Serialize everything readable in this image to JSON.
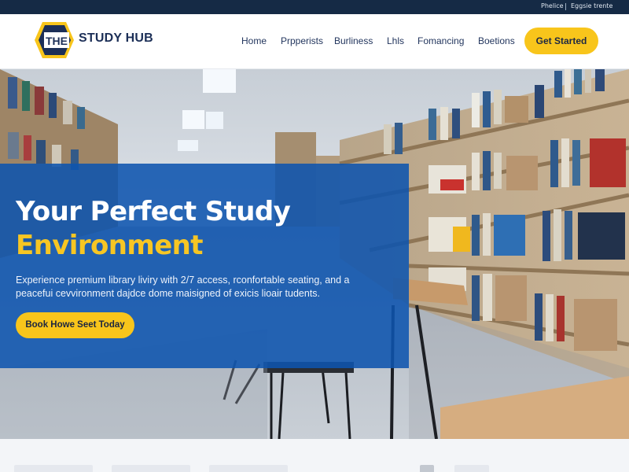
{
  "topbar": {
    "links": [
      "Phelice",
      "Eggsie trente"
    ]
  },
  "brand": {
    "logo_mark": "THE",
    "name": "STUDY HUB",
    "colors": {
      "navy": "#1c2f57",
      "accent": "#f8c51b",
      "overlay": "#0e54ae"
    }
  },
  "nav": {
    "items": [
      "Home",
      "Prpperists",
      "Burliness",
      "Lhls",
      "Fomancing",
      "Boetions"
    ],
    "cta_label": "Get Started"
  },
  "hero": {
    "title_line1": "Your Perfect Study",
    "title_line2": "Environment",
    "description": "Experience premium library liviry with 2/7 access, rconfortable seating, and a peacefui cevvironment dajdce dome maisigned of exicis lioair tudents.",
    "button_label": "Book Howe Seet Today"
  }
}
